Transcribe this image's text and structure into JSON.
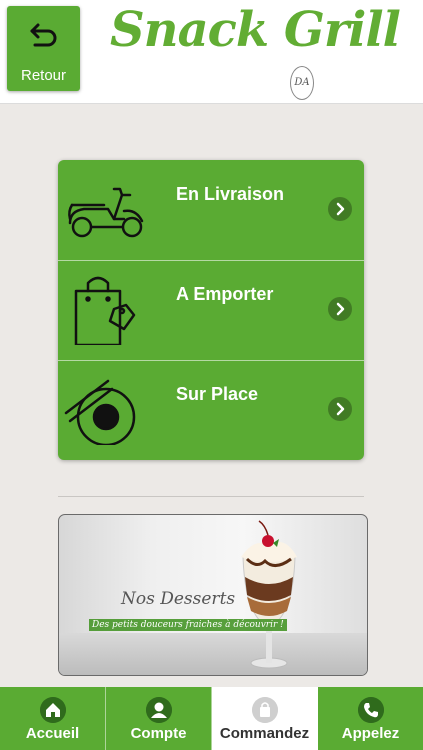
{
  "header": {
    "back_label": "Retour",
    "logo_text": "Snack Grill",
    "logo_badge": "DA"
  },
  "menu": {
    "items": [
      {
        "label": "En Livraison",
        "icon": "scooter-icon"
      },
      {
        "label": "A Emporter",
        "icon": "shopping-bag-icon"
      },
      {
        "label": "Sur Place",
        "icon": "plate-chopsticks-icon"
      }
    ]
  },
  "promo": {
    "title": "Nos Desserts",
    "subtitle": "Des petits douceurs fraiches à découvrir !"
  },
  "tabbar": {
    "tabs": [
      {
        "label": "Accueil",
        "icon": "home-icon",
        "active": false
      },
      {
        "label": "Compte",
        "icon": "user-icon",
        "active": false
      },
      {
        "label": "Commandez",
        "icon": "bag-icon",
        "active": true
      },
      {
        "label": "Appelez",
        "icon": "phone-icon",
        "active": false
      }
    ]
  },
  "colors": {
    "brand_green": "#5aab33",
    "background": "#ece9e6"
  }
}
